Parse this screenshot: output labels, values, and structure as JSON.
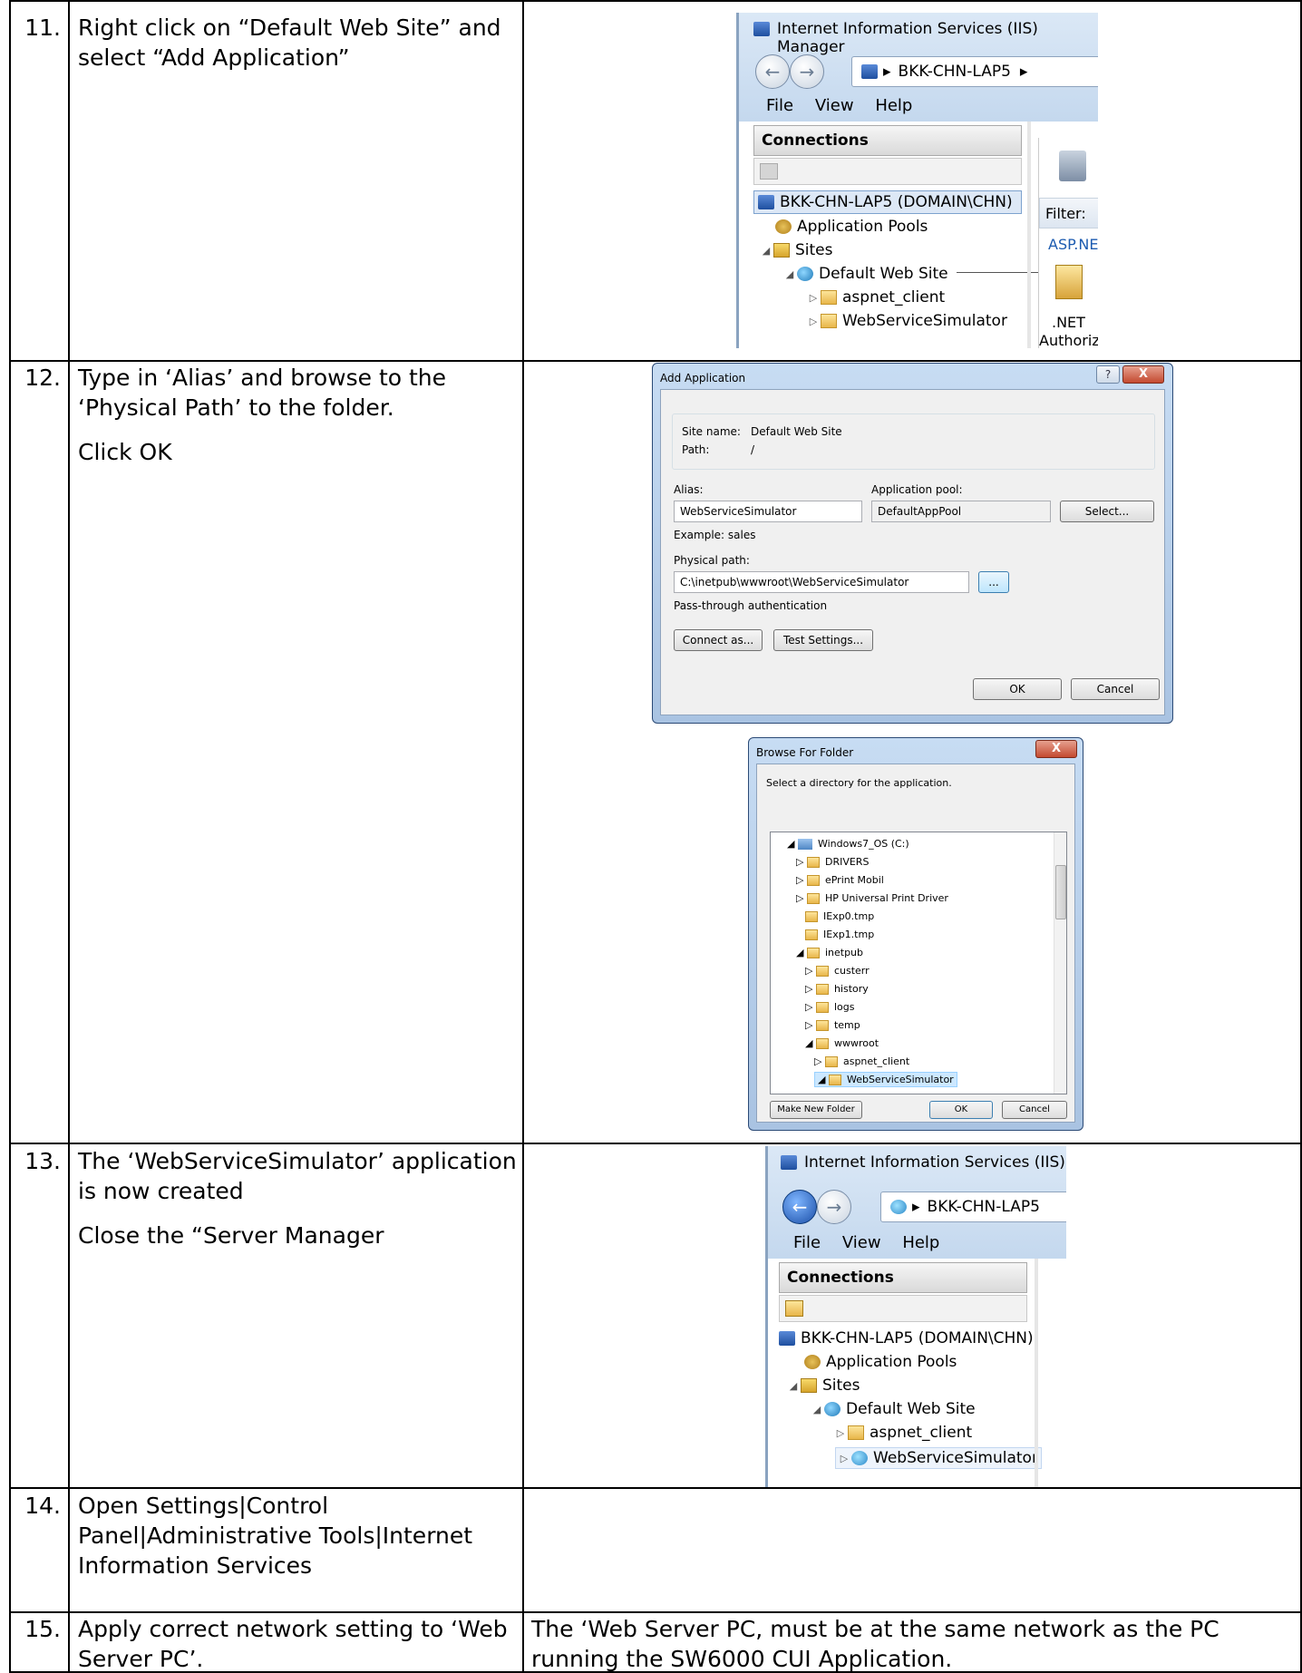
{
  "steps": [
    {
      "number": "11.",
      "lines": [
        "Right click on “Default Web Site” and select “Add Application”"
      ],
      "note": ""
    },
    {
      "number": "12.",
      "lines": [
        "Type in ‘Alias’ and browse to the ‘Physical Path’ to the folder.",
        "Click OK"
      ],
      "note": ""
    },
    {
      "number": "13.",
      "lines": [
        "The ‘WebServiceSimulator’ application is now created",
        "Close the “Server Manager"
      ],
      "note": ""
    },
    {
      "number": "14.",
      "lines": [
        "Open Settings|Control Panel|Administrative Tools|Internet Information Services"
      ],
      "note": ""
    },
    {
      "number": "15.",
      "lines": [
        "Apply correct network setting to ‘Web Server PC’."
      ],
      "note": "The ‘Web Server PC, must be at the same network as the PC running the SW6000 CUI Application."
    }
  ],
  "iis1": {
    "title": "Internet Information Services (IIS) Manager",
    "address": "BKK-CHN-LAP5",
    "menu": [
      "File",
      "View",
      "Help"
    ],
    "connections": "Connections",
    "tree": [
      "BKK-CHN-LAP5 (DOMAIN\\CHN)",
      "Application Pools",
      "Sites",
      "Default Web Site",
      "aspnet_client",
      "WebServiceSimulator"
    ],
    "filter_label": "Filter:",
    "asp_label": "ASP.NE",
    "net_label": ".NET",
    "authoriz_label": "Authoriz"
  },
  "add_app": {
    "title": "Add Application",
    "help": "?",
    "close": "X",
    "site_name_label": "Site name:",
    "site_name_value": "Default Web Site",
    "path_label": "Path:",
    "path_value": "/",
    "alias_label": "Alias:",
    "alias_value": "WebServiceSimulator",
    "pool_label": "Application pool:",
    "pool_value": "DefaultAppPool",
    "select_button": "Select...",
    "example": "Example: sales",
    "physical_label": "Physical path:",
    "physical_value": "C:\\inetpub\\wwwroot\\WebServiceSimulator",
    "browse_button": "...",
    "passthrough": "Pass-through authentication",
    "connect_button": "Connect as...",
    "test_button": "Test Settings...",
    "ok": "OK",
    "cancel": "Cancel"
  },
  "browse": {
    "title": "Browse For Folder",
    "close": "X",
    "prompt": "Select a directory for the application.",
    "items": [
      "Windows7_OS (C:)",
      "DRIVERS",
      "ePrint Mobil",
      "HP Universal Print Driver",
      "IExp0.tmp",
      "IExp1.tmp",
      "inetpub",
      "custerr",
      "history",
      "logs",
      "temp",
      "wwwroot",
      "aspnet_client",
      "WebServiceSimulator"
    ],
    "new_folder": "Make New Folder",
    "ok": "OK",
    "cancel": "Cancel"
  },
  "iis2": {
    "title": "Internet Information Services (IIS) Ma",
    "address": "BKK-CHN-LAP5",
    "menu": [
      "File",
      "View",
      "Help"
    ],
    "connections": "Connections",
    "tree": [
      "BKK-CHN-LAP5 (DOMAIN\\CHN)",
      "Application Pools",
      "Sites",
      "Default Web Site",
      "aspnet_client",
      "WebServiceSimulator"
    ]
  }
}
